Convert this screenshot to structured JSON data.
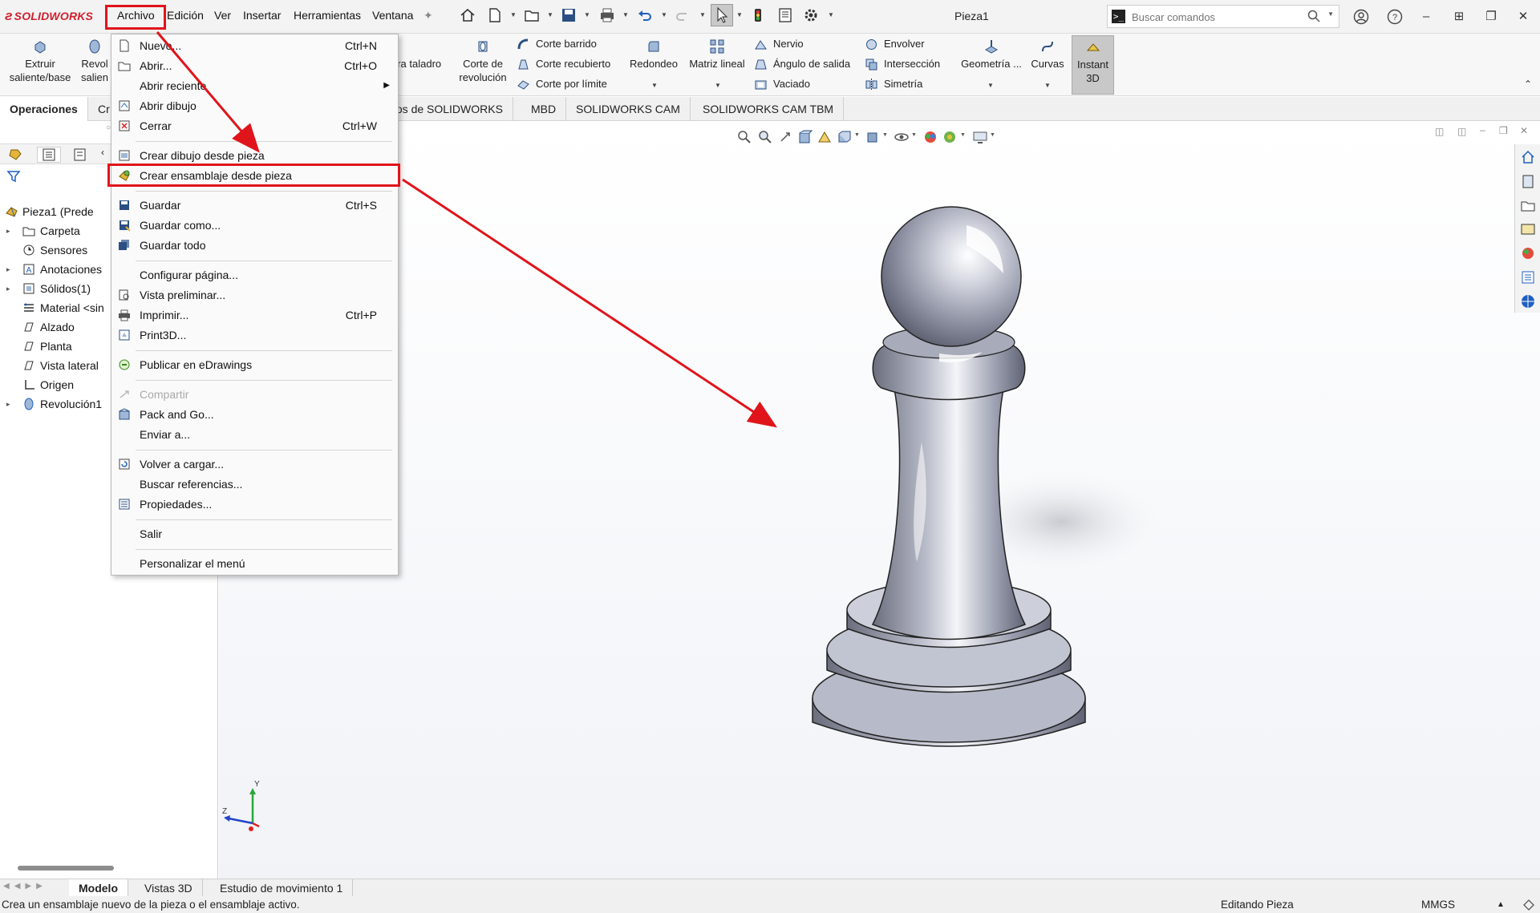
{
  "app": {
    "logo": "SOLIDWORKS",
    "document_title": "Pieza1"
  },
  "menubar": [
    "Archivo",
    "Edición",
    "Ver",
    "Insertar",
    "Herramientas",
    "Ventana"
  ],
  "search": {
    "placeholder": "Buscar comandos"
  },
  "ribbon": {
    "extrude": "Extruir saliente/base",
    "revolve": "Revol salien",
    "hole_wizard_partial": "ara taladro",
    "cut_revolve": "Corte de revolución",
    "cut_sweep": "Corte barrido",
    "cut_loft": "Corte recubierto",
    "cut_boundary": "Corte por límite",
    "fillet": "Redondeo",
    "linear_pattern": "Matriz lineal",
    "rib": "Nervio",
    "draft": "Ángulo de salida",
    "shell": "Vaciado",
    "wrap": "Envolver",
    "intersect": "Intersección",
    "mirror": "Simetría",
    "ref_geometry": "Geometría ...",
    "curves": "Curvas",
    "instant3d": "Instant 3D"
  },
  "tabs": {
    "operations": "Operaciones",
    "sketch_partial": "Cr",
    "addins_partial": "tos de SOLIDWORKS",
    "mbd": "MBD",
    "cam": "SOLIDWORKS CAM",
    "cam_tbm": "SOLIDWORKS CAM TBM"
  },
  "tree": [
    {
      "label": "Pieza1 (Prede",
      "icon": "part-icon",
      "expand": false
    },
    {
      "label": "Carpeta",
      "icon": "folder-icon",
      "expand": true
    },
    {
      "label": "Sensores",
      "icon": "sensor-icon",
      "expand": false
    },
    {
      "label": "Anotaciones",
      "icon": "annotation-icon",
      "expand": true
    },
    {
      "label": "Sólidos(1)",
      "icon": "solid-bodies-icon",
      "expand": true
    },
    {
      "label": "Material <sin",
      "icon": "material-icon",
      "expand": false
    },
    {
      "label": "Alzado",
      "icon": "plane-icon",
      "expand": false
    },
    {
      "label": "Planta",
      "icon": "plane-icon",
      "expand": false
    },
    {
      "label": "Vista lateral",
      "icon": "plane-icon",
      "expand": false
    },
    {
      "label": "Origen",
      "icon": "origin-icon",
      "expand": false
    },
    {
      "label": "Revolución1",
      "icon": "revolve-feature-icon",
      "expand": true
    }
  ],
  "file_menu": {
    "items": [
      {
        "label": "Nuevo...",
        "shortcut": "Ctrl+N",
        "icon": "new-doc-icon"
      },
      {
        "label": "Abrir...",
        "shortcut": "Ctrl+O",
        "icon": "open-icon"
      },
      {
        "label": "Abrir reciente",
        "shortcut": "",
        "icon": ""
      },
      {
        "label": "Abrir dibujo",
        "shortcut": "",
        "icon": "open-drawing-icon"
      },
      {
        "label": "Cerrar",
        "shortcut": "Ctrl+W",
        "icon": "close-doc-icon"
      },
      {
        "label": "Crear dibujo desde pieza",
        "shortcut": "",
        "icon": "make-drawing-icon"
      },
      {
        "label": "Crear ensamblaje desde pieza",
        "shortcut": "",
        "icon": "make-assembly-icon"
      },
      {
        "label": "Guardar",
        "shortcut": "Ctrl+S",
        "icon": "save-icon"
      },
      {
        "label": "Guardar como...",
        "shortcut": "",
        "icon": "save-as-icon"
      },
      {
        "label": "Guardar todo",
        "shortcut": "",
        "icon": "save-all-icon"
      },
      {
        "label": "Configurar página...",
        "shortcut": "",
        "icon": ""
      },
      {
        "label": "Vista preliminar...",
        "shortcut": "",
        "icon": "print-preview-icon"
      },
      {
        "label": "Imprimir...",
        "shortcut": "Ctrl+P",
        "icon": "print-icon"
      },
      {
        "label": "Print3D...",
        "shortcut": "",
        "icon": "print3d-icon"
      },
      {
        "label": "Publicar en eDrawings",
        "shortcut": "",
        "icon": "edrawings-icon"
      },
      {
        "label": "Compartir",
        "shortcut": "",
        "icon": "share-icon"
      },
      {
        "label": "Pack and Go...",
        "shortcut": "",
        "icon": "pack-and-go-icon"
      },
      {
        "label": "Enviar a...",
        "shortcut": "",
        "icon": ""
      },
      {
        "label": "Volver a cargar...",
        "shortcut": "",
        "icon": "reload-icon"
      },
      {
        "label": "Buscar referencias...",
        "shortcut": "",
        "icon": ""
      },
      {
        "label": "Propiedades...",
        "shortcut": "",
        "icon": "properties-icon"
      },
      {
        "label": "Salir",
        "shortcut": "",
        "icon": ""
      },
      {
        "label": "Personalizar el menú",
        "shortcut": "",
        "icon": ""
      }
    ]
  },
  "bottom_tabs": [
    "Modelo",
    "Vistas 3D",
    "Estudio de movimiento 1"
  ],
  "status": {
    "message": "Crea un ensamblaje nuevo de la pieza o el ensamblaje activo.",
    "mode": "Editando Pieza",
    "units": "MMGS"
  },
  "triad": {
    "y": "Y",
    "z": "Z"
  },
  "colors": {
    "brand_red": "#d2202f",
    "annotation_red": "#e0141b",
    "accent_blue": "#1f5fbf"
  }
}
